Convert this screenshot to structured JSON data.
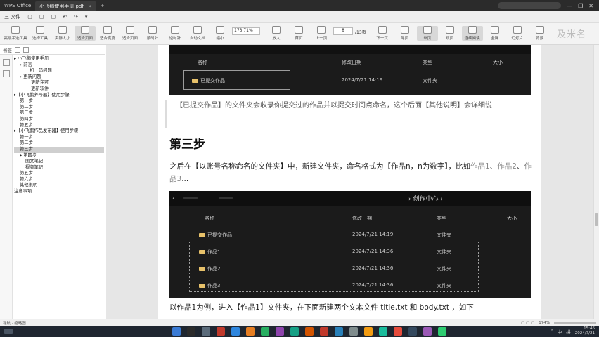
{
  "titlebar": {
    "app": "WPS Office",
    "tab_title": "小飞鹅使用手册.pdf",
    "tab_close": "×",
    "new_tab": "+",
    "controls": [
      "—",
      "❐",
      "✕"
    ]
  },
  "menubar": {
    "items": [
      "三 文件",
      "▢",
      "▢",
      "▢",
      "↶",
      "↷",
      "▾"
    ]
  },
  "toolbar": {
    "buttons": [
      {
        "label": "高级手选工具"
      },
      {
        "label": "选择工具"
      },
      {
        "label": "实际大小"
      },
      {
        "label": "适合页面"
      },
      {
        "label": "适合宽度"
      },
      {
        "label": "适合页面"
      },
      {
        "label": "顺时针"
      },
      {
        "label": "逆时针"
      },
      {
        "label": "自动文档"
      },
      {
        "label": "缩小"
      }
    ],
    "zoom": "173.71%",
    "right_buttons": [
      {
        "label": "放大"
      },
      {
        "label": "首页"
      },
      {
        "label": "上一页"
      }
    ],
    "page_current": "8",
    "page_total": "/13页",
    "right_buttons2": [
      {
        "label": "下一页"
      },
      {
        "label": "尾页"
      },
      {
        "label": "单页"
      },
      {
        "label": "双页"
      },
      {
        "label": "连续阅读"
      },
      {
        "label": "全屏"
      },
      {
        "label": "幻灯片"
      },
      {
        "label": "背景"
      }
    ],
    "watermark": "及米名"
  },
  "left_panel": {
    "header": "书签",
    "tree": [
      {
        "label": "▸ 小飞鹅使用手册",
        "level": 0
      },
      {
        "label": "▸ 前言",
        "level": 1
      },
      {
        "label": "一机一码问题",
        "level": 2
      },
      {
        "label": "▸ 更新问题",
        "level": 1
      },
      {
        "label": "更新许可",
        "level": 3
      },
      {
        "label": "更新软件",
        "level": 3
      },
      {
        "label": "▸【小飞鹅养号器】使用步骤",
        "level": 0
      },
      {
        "label": "第一步",
        "level": 1
      },
      {
        "label": "第二步",
        "level": 1
      },
      {
        "label": "第三步",
        "level": 1
      },
      {
        "label": "第四步",
        "level": 1
      },
      {
        "label": "第五步",
        "level": 1
      },
      {
        "label": "▸【小飞鹅作品发布器】使用步骤",
        "level": 0
      },
      {
        "label": "第一步",
        "level": 1
      },
      {
        "label": "第二步",
        "level": 1
      },
      {
        "label": "第三步",
        "level": 1,
        "selected": true
      },
      {
        "label": "▸ 第四步",
        "level": 1
      },
      {
        "label": "图文笔记",
        "level": 2
      },
      {
        "label": "视频笔记",
        "level": 2
      },
      {
        "label": "第五步",
        "level": 1
      },
      {
        "label": "第六步",
        "level": 1
      },
      {
        "label": "其他说明",
        "level": 1
      },
      {
        "label": "注意事项",
        "level": 0
      }
    ]
  },
  "document": {
    "shot1": {
      "headers": {
        "name": "名称",
        "date": "修改日期",
        "type": "类型",
        "size": "大小"
      },
      "rows": [
        {
          "name": "已提交作品",
          "date": "2024/7/21 14:19",
          "type": "文件夹"
        }
      ]
    },
    "quote": "【已提交作品】的文件夹会收录你提交过的作品并以提交时间点命名，这个后面【其他说明】会详细说",
    "heading": "第三步",
    "para_main": "之后在【以账号名称命名的文件夹】中，新建文件夹，命名格式为【作品n，n为数字】，比如",
    "para_ex1": "作品1",
    "para_sep1": "、",
    "para_ex2": "作品2",
    "para_sep2": "、",
    "para_ex3": "作品3",
    "para_end": "...",
    "shot2": {
      "chevron": "›",
      "breadcrumb": "› 创作中心 ›",
      "headers": {
        "name": "名称",
        "date": "修改日期",
        "type": "类型",
        "size": "大小"
      },
      "rows": [
        {
          "name": "已提交作品",
          "date": "2024/7/21 14:19",
          "type": "文件夹"
        },
        {
          "name": "作品1",
          "date": "2024/7/21 14:36",
          "type": "文件夹"
        },
        {
          "name": "作品2",
          "date": "2024/7/21 14:36",
          "type": "文件夹"
        },
        {
          "name": "作品3",
          "date": "2024/7/21 14:36",
          "type": "文件夹"
        }
      ]
    },
    "para2": "以作品1为例，进入【作品1】文件夹，在下面新建两个文本文件 title.txt 和 body.txt ，如下"
  },
  "statusbar": {
    "left": "导航 · 缩略图",
    "zoom": "174%",
    "icons": "▢ ▢ ▢"
  },
  "taskbar": {
    "ime": "中",
    "lang": "拼",
    "time": "15:46",
    "date": "2024/7/21",
    "icon_colors": [
      "#3a7bd5",
      "#2b2b2b",
      "#5b6b7a",
      "#c0392b",
      "#2e86de",
      "#e67e22",
      "#27ae60",
      "#8e44ad",
      "#16a085",
      "#d35400",
      "#c0392b",
      "#2980b9",
      "#7f8c8d",
      "#f39c12",
      "#1abc9c",
      "#e74c3c",
      "#34495e",
      "#9b59b6",
      "#2ecc71"
    ]
  }
}
